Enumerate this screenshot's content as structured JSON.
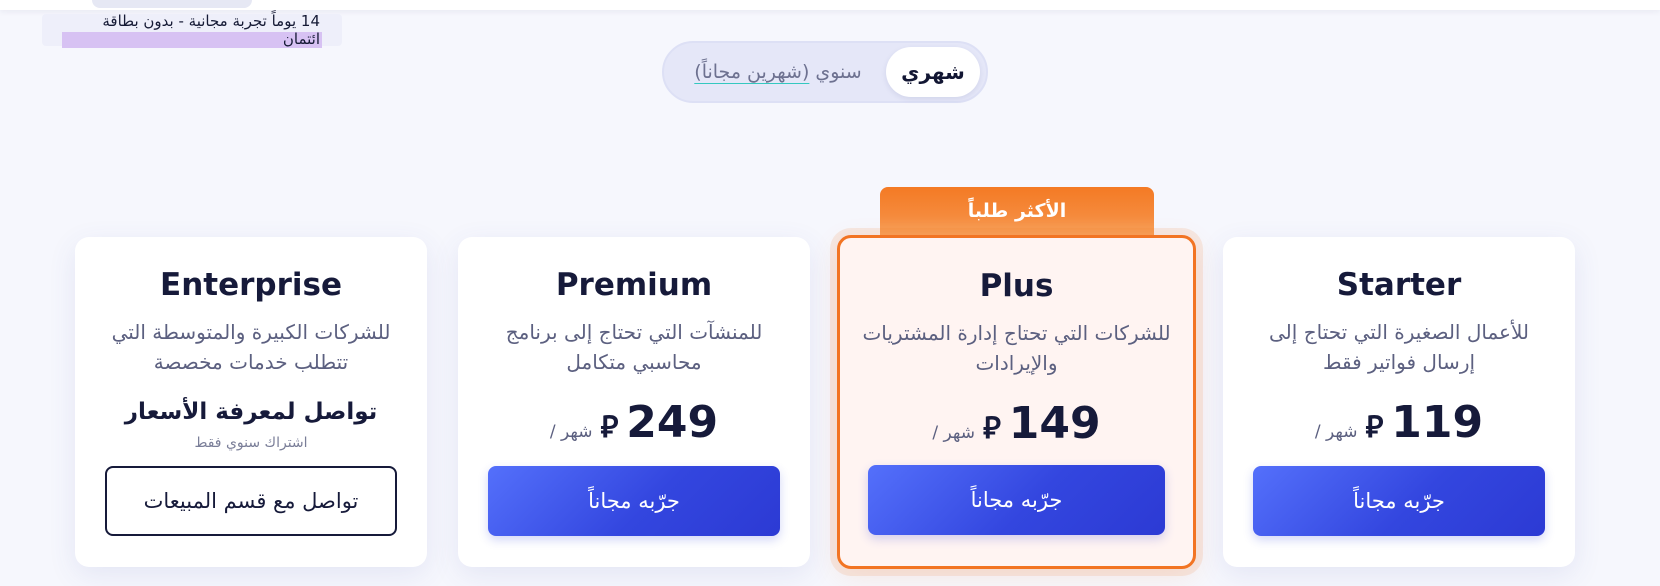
{
  "trial_note": "14 يوماً تجربة مجانية - بدون بطاقة ائتمان",
  "billing_toggle": {
    "monthly_label": "شهري",
    "annual_label": "سنوي",
    "annual_free_label": "(شهرين مجاناً)",
    "selected": "monthly"
  },
  "popular_badge": "الأكثر طلباً",
  "plans": [
    {
      "name": "Starter",
      "description": "للأعمال الصغيرة التي تحتاج إلى إرسال فواتير فقط",
      "price": "119",
      "currency_symbol": "⃁",
      "per_month": "/ شهر",
      "cta": "جرّبه مجاناً"
    },
    {
      "name": "Plus",
      "description": "للشركات التي تحتاج إدارة المشتريات والإيرادات",
      "price": "149",
      "currency_symbol": "⃁",
      "per_month": "/ شهر",
      "cta": "جرّبه مجاناً"
    },
    {
      "name": "Premium",
      "description": "للمنشآت التي تحتاج إلى برنامج محاسبي متكامل",
      "price": "249",
      "currency_symbol": "⃁",
      "per_month": "/ شهر",
      "cta": "جرّبه مجاناً"
    },
    {
      "name": "Enterprise",
      "description": "للشركات الكبيرة والمتوسطة التي تتطلب خدمات مخصصة",
      "contact_title": "تواصل لمعرفة الأسعار",
      "annual_only": "اشتراك سنوي فقط",
      "cta": "تواصل مع قسم المبيعات"
    }
  ],
  "colors": {
    "accent_blue": "#3346df",
    "featured_orange": "#f27423",
    "background": "#f6f7fd"
  }
}
